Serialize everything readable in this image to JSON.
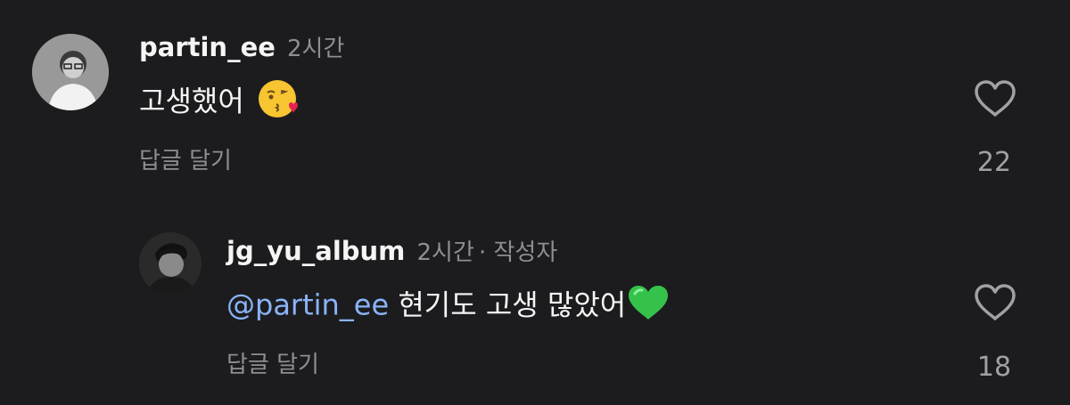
{
  "comments": [
    {
      "username": "partin_ee",
      "time": "2시간",
      "author_tag": "",
      "text": "고생했어",
      "emoji": "kissing-face-with-heart-emoji",
      "reply_label": "답글 달기",
      "likes": "22"
    },
    {
      "username": "jg_yu_album",
      "time": "2시간",
      "author_tag": "· 작성자",
      "mention": "@partin_ee",
      "text": "현기도 고생 많았어",
      "emoji": "green-heart-emoji",
      "reply_label": "답글 달기",
      "likes": "18"
    }
  ],
  "colors": {
    "background": "#1c1c1e",
    "mention": "#8ab4f8",
    "muted": "#8e8e93"
  }
}
